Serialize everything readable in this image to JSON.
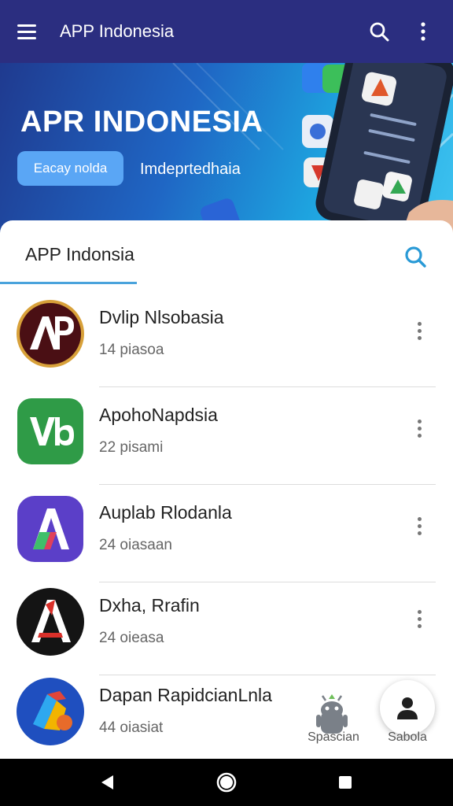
{
  "appbar": {
    "title": "APP Indonesia",
    "menu_icon": "hamburger-menu-icon",
    "search_icon": "search-icon",
    "overflow_icon": "more-vertical-icon",
    "background": "#2b2e80"
  },
  "banner": {
    "headline": "APR INDONESIA",
    "button_label": "Eacay nolda",
    "subtitle": "Imdeprtedhaia"
  },
  "sheet": {
    "title": "APP Indonsia",
    "search_icon": "search-icon",
    "accent": "#4aa3dc"
  },
  "apps": [
    {
      "name": "Dvlip Nlsobasia",
      "meta": "14 piasoa"
    },
    {
      "name": "ApohoNapdsia",
      "meta": "22 pisami"
    },
    {
      "name": "Auplab Rlodanla",
      "meta": "24 oiasaan"
    },
    {
      "name": "Dxha, Rrafin",
      "meta": "24 oieasa"
    },
    {
      "name": "Dapan RapidcianLnla",
      "meta": "44 oiasiat"
    }
  ],
  "bottom_actions": {
    "android_label": "Spascian",
    "profile_label": "Sabola"
  },
  "navbar": {
    "back_icon": "back-triangle-icon",
    "home_icon": "home-circle-icon",
    "recents_icon": "recents-square-icon"
  }
}
